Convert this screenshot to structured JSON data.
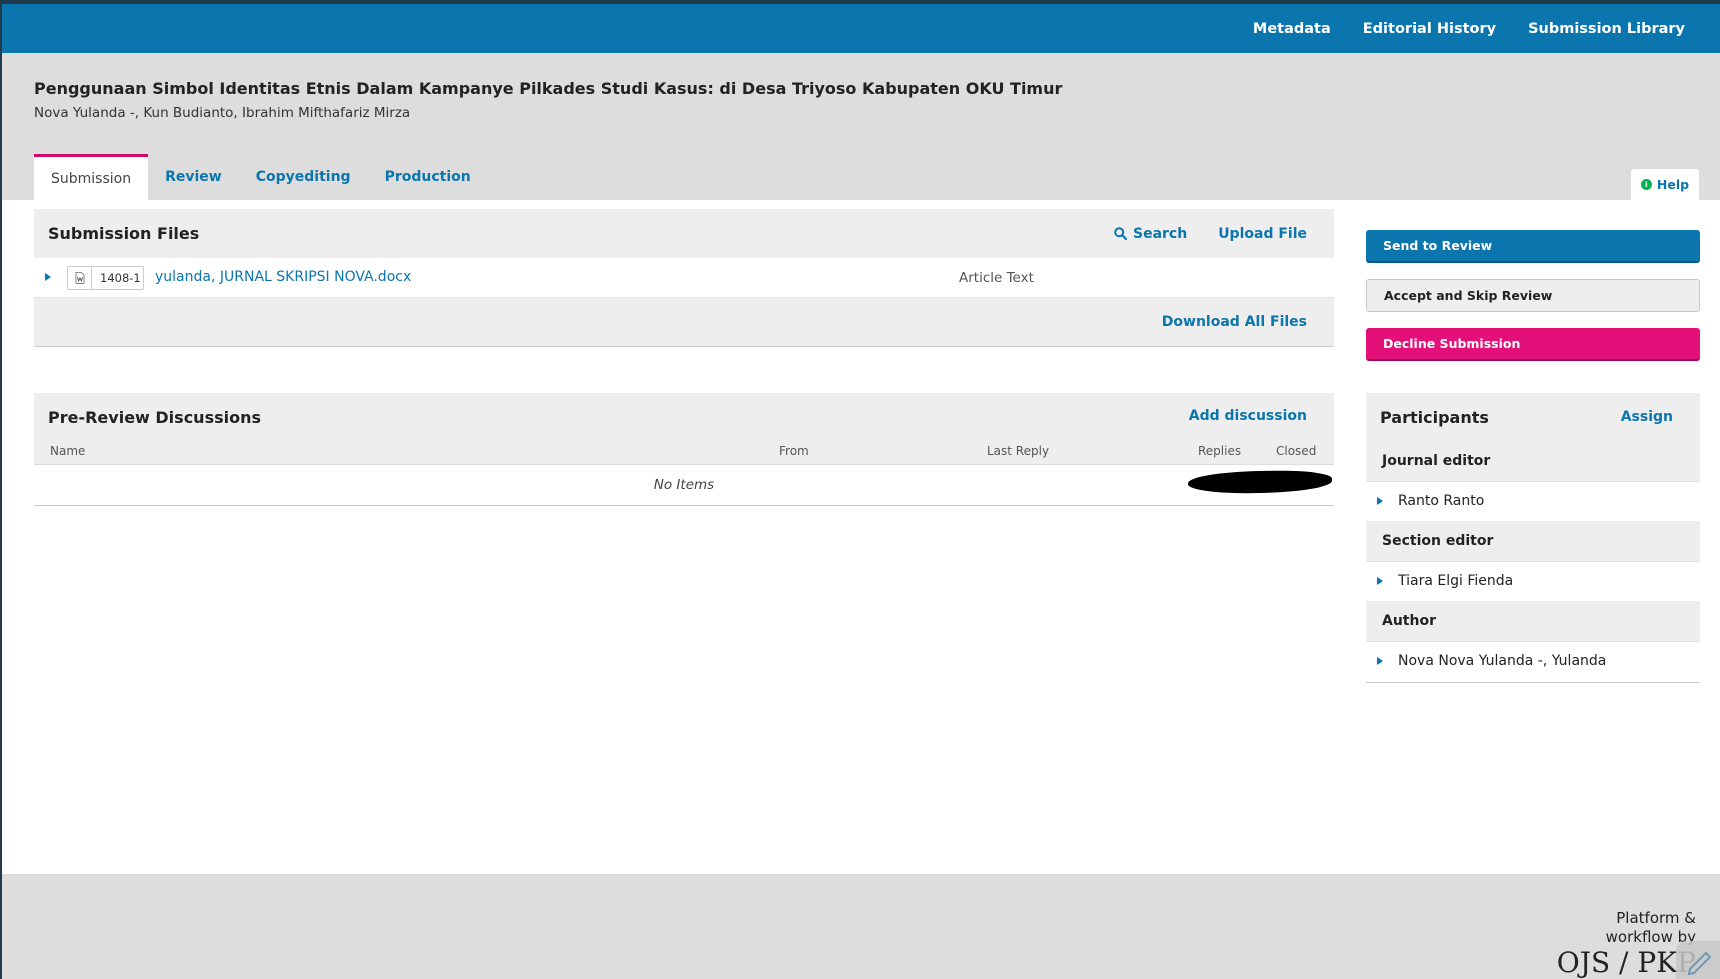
{
  "topnav": {
    "metadata": "Metadata",
    "editorial_history": "Editorial History",
    "submission_library": "Submission Library"
  },
  "submission": {
    "title": "Penggunaan Simbol Identitas Etnis Dalam Kampanye Pilkades Studi Kasus: di Desa Triyoso Kabupaten OKU Timur",
    "authors": "Nova Yulanda -, Kun Budianto, Ibrahim Mifthafariz Mirza"
  },
  "tabs": [
    {
      "label": "Submission"
    },
    {
      "label": "Review"
    },
    {
      "label": "Copyediting"
    },
    {
      "label": "Production"
    }
  ],
  "help": {
    "label": "Help"
  },
  "submission_files": {
    "title": "Submission Files",
    "search_label": "Search",
    "upload_label": "Upload File",
    "files": [
      {
        "id": "1408-1",
        "name": "yulanda, JURNAL SKRIPSI NOVA.docx",
        "type": "Article Text"
      }
    ],
    "download_all": "Download All Files"
  },
  "discussions": {
    "title": "Pre-Review Discussions",
    "add_label": "Add discussion",
    "columns": {
      "name": "Name",
      "from": "From",
      "last_reply": "Last Reply",
      "replies": "Replies",
      "closed": "Closed"
    },
    "empty": "No Items"
  },
  "actions": {
    "send_to_review": "Send to Review",
    "accept_skip": "Accept and Skip Review",
    "decline": "Decline Submission"
  },
  "participants": {
    "title": "Participants",
    "assign_label": "Assign",
    "groups": [
      {
        "role": "Journal editor",
        "people": [
          "Ranto Ranto"
        ]
      },
      {
        "role": "Section editor",
        "people": [
          "Tiara Elgi Fienda"
        ]
      },
      {
        "role": "Author",
        "people": [
          "Nova Nova Yulanda -, Yulanda"
        ]
      }
    ]
  },
  "footer": {
    "line1": "Platform &",
    "line2": "workflow by",
    "brand": "OJS / PKP"
  },
  "colors": {
    "primary": "#0a76ad",
    "danger": "#e4107a",
    "tab_accent": "#d00a6c",
    "help_info": "#00b24e"
  }
}
